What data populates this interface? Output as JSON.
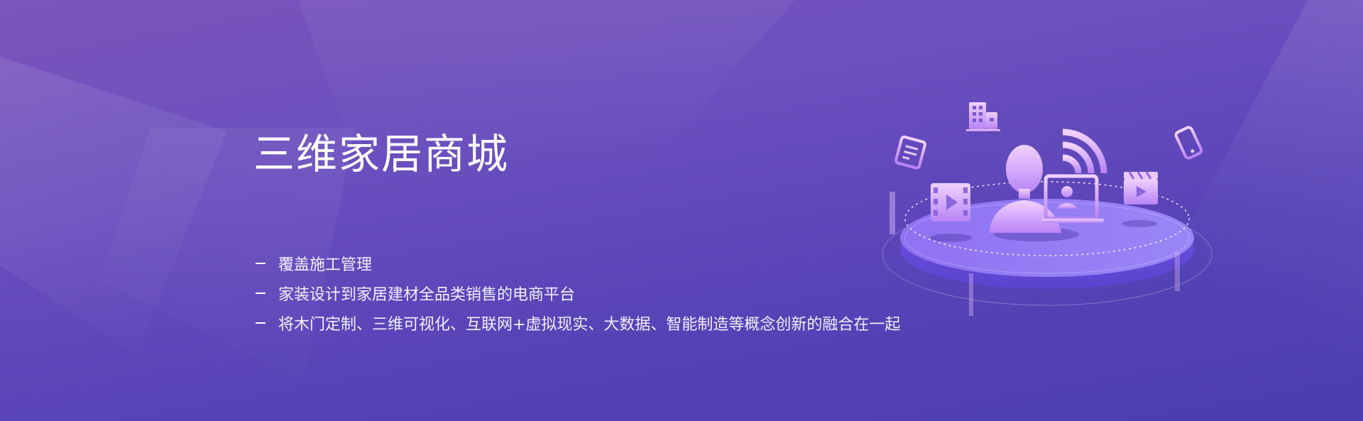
{
  "banner": {
    "title": "三维家居商城",
    "bullets": [
      "覆盖施工管理",
      "家装设计到家居建材全品类销售的电商平台",
      "将木门定制、三维可视化、互联网+虚拟现实、大数据、智能制造等概念创新的融合在一起"
    ]
  },
  "icons": [
    "building-icon",
    "notepad-icon",
    "wifi-signal-icon",
    "phone-icon",
    "film-play-icon",
    "clapperboard-play-icon",
    "user-avatar-icon",
    "laptop-user-icon"
  ],
  "colors": {
    "background_top": "#7b55bb",
    "background_bottom": "#4a3db0",
    "platform": "#8a6cf0",
    "icon_gradient_light": "#e9c6ff",
    "icon_gradient_dark": "#b27cf5"
  }
}
